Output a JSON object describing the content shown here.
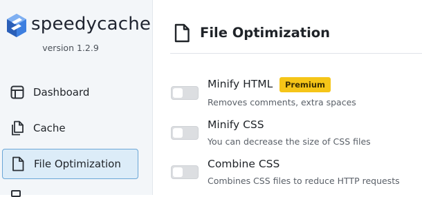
{
  "brand": {
    "name": "speedycache",
    "version": "version 1.2.9"
  },
  "sidebar": {
    "items": [
      {
        "label": "Dashboard",
        "icon": "layout-icon"
      },
      {
        "label": "Cache",
        "icon": "files-icon"
      },
      {
        "label": "File Optimization",
        "icon": "file-icon",
        "active": true
      }
    ]
  },
  "main": {
    "title": "File Optimization",
    "options": [
      {
        "title": "Minify HTML",
        "badge": "Premium",
        "description": "Removes comments, extra spaces",
        "enabled": false
      },
      {
        "title": "Minify CSS",
        "description": "You can decrease the size of CSS files",
        "enabled": false
      },
      {
        "title": "Combine CSS",
        "description": "Combines CSS files to reduce HTTP requests",
        "enabled": false
      }
    ]
  },
  "colors": {
    "accent": "#6aa6d6",
    "active_bg": "#dcecf8",
    "badge": "#f5c518",
    "logo": "#3d7fe0"
  }
}
